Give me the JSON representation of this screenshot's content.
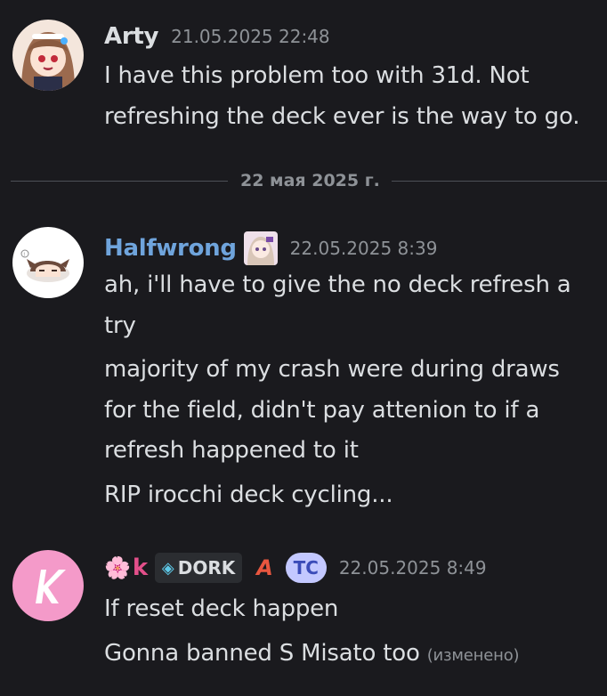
{
  "messages": [
    {
      "username": "Arty",
      "username_color": "#dbdee1",
      "timestamp": "21.05.2025 22:48",
      "lines": [
        "I have this problem too with 31d. Not",
        "refreshing the deck ever is the way to go."
      ]
    },
    {
      "username": "Halfwrong",
      "username_color": "#6fa4dc",
      "timestamp": "22.05.2025 8:39",
      "lines": [
        "ah, i'll have to give the no deck refresh a",
        "try",
        "majority of my crash were during draws",
        "for the field, didn't pay attenion to if a",
        "refresh happened to it",
        "RIP irocchi deck cycling..."
      ]
    },
    {
      "username_prefix": "🌸",
      "username": "k",
      "username_color": "#e34f8a",
      "tag_label": "DORK",
      "role_a": "A",
      "role_tc": "TC",
      "timestamp": "22.05.2025 8:49",
      "lines": [
        "If reset deck happen",
        "Gonna banned S Misato too"
      ],
      "edited_label": "(изменено)"
    }
  ],
  "date_divider": "22 мая 2025 г."
}
